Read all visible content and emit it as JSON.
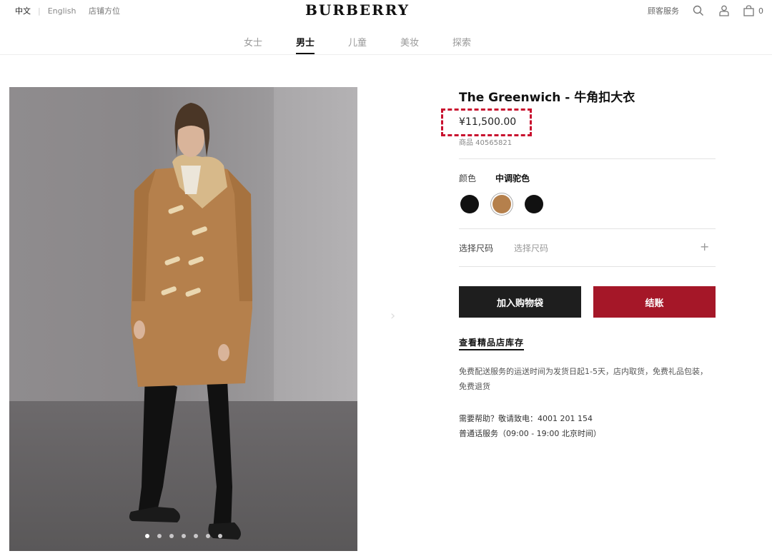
{
  "header": {
    "lang_cn": "中文",
    "lang_en": "English",
    "store_locator": "店铺方位",
    "logo": "BURBERRY",
    "customer_service": "顾客服务",
    "cart_count": "0"
  },
  "nav": {
    "items": [
      {
        "label": "女士"
      },
      {
        "label": "男士"
      },
      {
        "label": "儿童"
      },
      {
        "label": "美妆"
      },
      {
        "label": "探索"
      }
    ],
    "active_index": 1
  },
  "product": {
    "title": "The Greenwich - 牛角扣大衣",
    "price": "¥11,500.00",
    "sku": "商品 40565821",
    "color_label": "颜色",
    "color_value": "中调驼色",
    "swatches": [
      {
        "name": "black",
        "color": "#111111"
      },
      {
        "name": "camel",
        "color": "#b5804c"
      },
      {
        "name": "black-2",
        "color": "#111111"
      }
    ],
    "selected_swatch": 1,
    "size_label": "选择尺码",
    "size_placeholder": "选择尺码",
    "add_to_bag": "加入购物袋",
    "checkout": "结账",
    "store_stock": "查看精品店库存",
    "shipping_text": "免费配送服务的运送时间为发货日起1-5天，店内取货，免费礼品包装，免费退货",
    "help_line1": "需要帮助？敬请致电：4001 201 154",
    "help_line2": "普通话服务（09:00 - 19:00 北京时间）"
  },
  "gallery": {
    "dot_count": 7,
    "active_dot": 0
  },
  "colors": {
    "accent_red": "#a51728",
    "highlight_dashed": "#c8102e",
    "dark_button": "#1e1e1e"
  }
}
